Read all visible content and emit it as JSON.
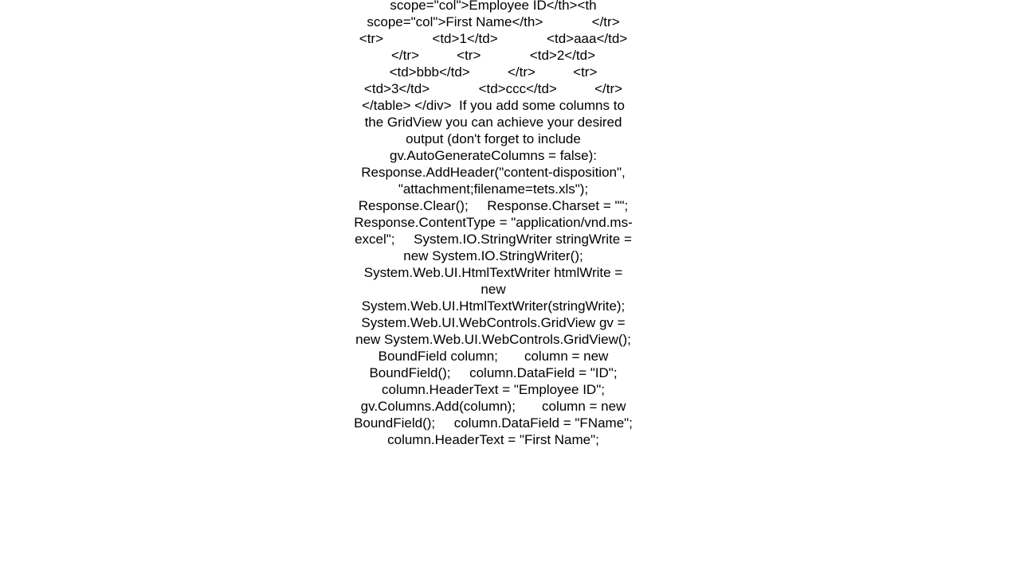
{
  "body_text": "scope=\"col\">Employee ID</th><th scope=\"col\">First Name</th>             </tr>          <tr>             <td>1</td>             <td>aaa</td>          </tr>          <tr>             <td>2</td>             <td>bbb</td>          </tr>          <tr>             <td>3</td>             <td>ccc</td>          </tr>     </table> </div>  If you add some columns to the GridView you can achieve your desired output (don't forget to include gv.AutoGenerateColumns = false):      Response.AddHeader(\"content-disposition\", \"attachment;filename=tets.xls\");     Response.Clear();     Response.Charset = \"\";     Response.ContentType = \"application/vnd.ms-excel\";     System.IO.StringWriter stringWrite = new System.IO.StringWriter();     System.Web.UI.HtmlTextWriter htmlWrite = new System.Web.UI.HtmlTextWriter(stringWrite);     System.Web.UI.WebControls.GridView gv = new System.Web.UI.WebControls.GridView();       BoundField column;       column = new BoundField();     column.DataField = \"ID\";     column.HeaderText = \"Employee ID\";     gv.Columns.Add(column);       column = new BoundField();     column.DataField = \"FName\";     column.HeaderText = \"First Name\";"
}
